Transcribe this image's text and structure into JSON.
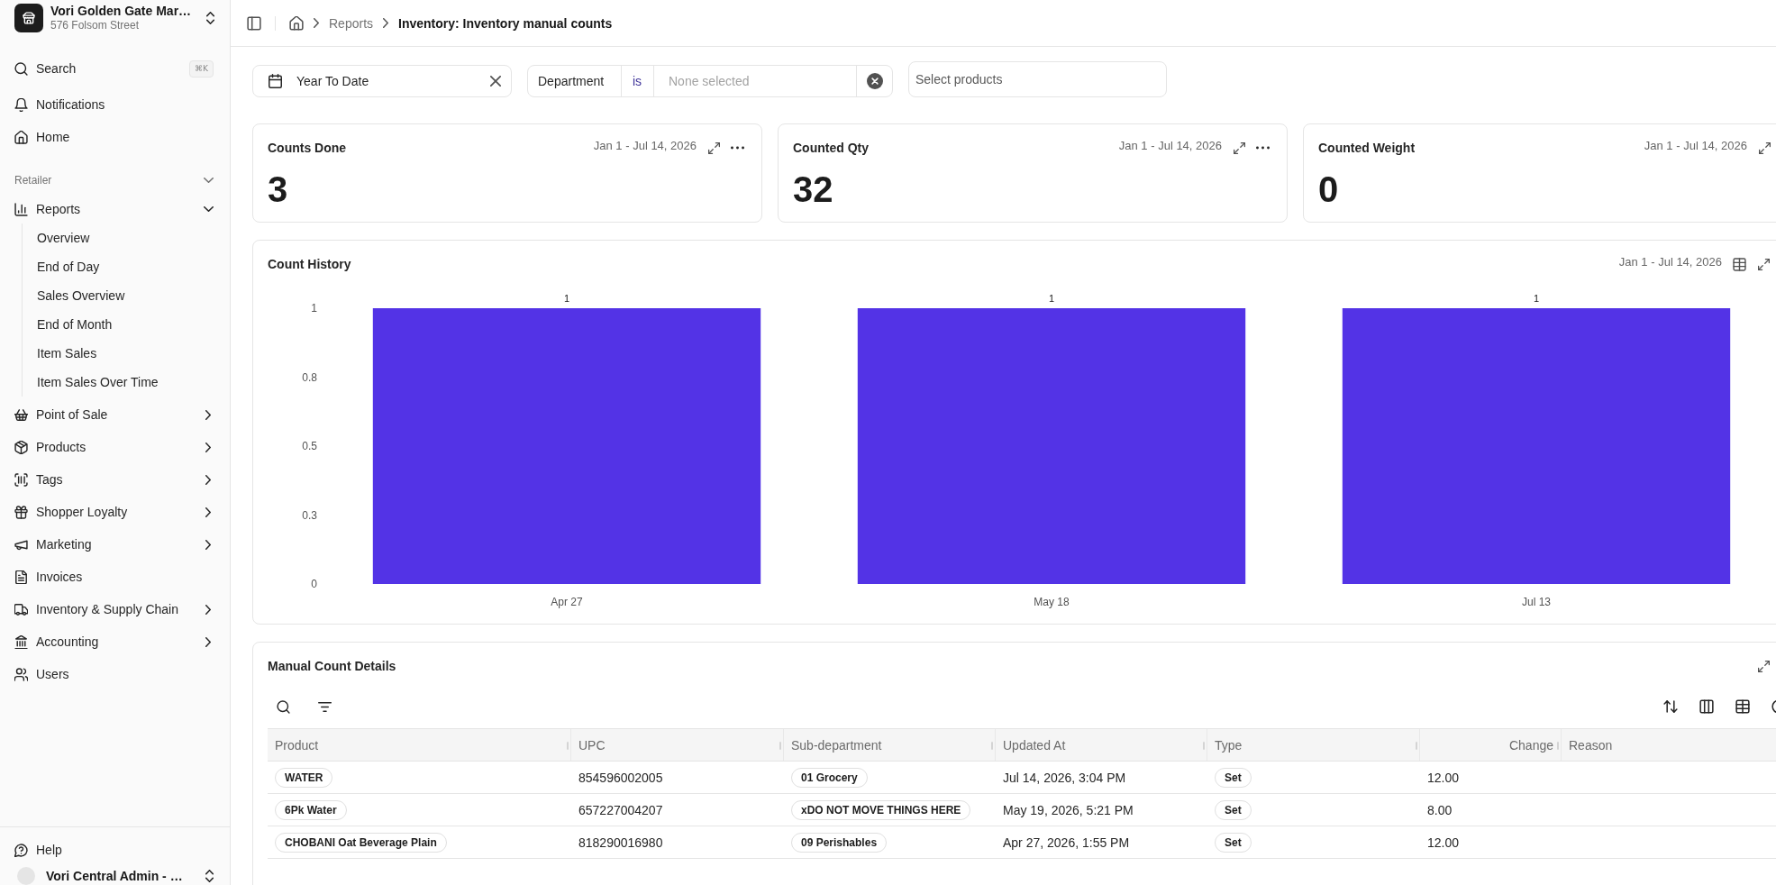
{
  "sidebar": {
    "store": {
      "name": "Vori Golden Gate Mar…",
      "address": "576 Folsom Street"
    },
    "search": {
      "label": "Search",
      "shortcut": "⌘K"
    },
    "top_items": [
      {
        "label": "Notifications"
      },
      {
        "label": "Home"
      }
    ],
    "section": {
      "label": "Retailer",
      "expanded": true
    },
    "items": [
      {
        "label": "Reports",
        "expandable": true,
        "expanded": true,
        "children": [
          {
            "label": "Overview"
          },
          {
            "label": "End of Day"
          },
          {
            "label": "Sales Overview"
          },
          {
            "label": "End of Month"
          },
          {
            "label": "Item Sales"
          },
          {
            "label": "Item Sales Over Time"
          }
        ]
      },
      {
        "label": "Point of Sale",
        "expandable": true,
        "expanded": false
      },
      {
        "label": "Products",
        "expandable": true,
        "expanded": false
      },
      {
        "label": "Tags",
        "expandable": true,
        "expanded": false
      },
      {
        "label": "Shopper Loyalty",
        "expandable": true,
        "expanded": false
      },
      {
        "label": "Marketing",
        "expandable": true,
        "expanded": false
      },
      {
        "label": "Invoices",
        "expandable": false
      },
      {
        "label": "Inventory & Supply Chain",
        "expandable": true,
        "expanded": false
      },
      {
        "label": "Accounting",
        "expandable": true,
        "expanded": false
      },
      {
        "label": "Users",
        "expandable": false
      }
    ],
    "footer": {
      "help": "Help",
      "account": "Vori Central Admin - …"
    }
  },
  "topbar": {
    "breadcrumbs": [
      {
        "label": "Reports",
        "current": false
      },
      {
        "label": "Inventory: Inventory manual counts",
        "current": true
      }
    ]
  },
  "filters": {
    "date": {
      "value": "Year To Date"
    },
    "department": {
      "label": "Department",
      "operator": "is",
      "placeholder": "None selected"
    },
    "products": {
      "placeholder": "Select products"
    }
  },
  "kpis": [
    {
      "title": "Counts Done",
      "range": "Jan 1 - Jul 14, 2026",
      "value": "3",
      "menu": true
    },
    {
      "title": "Counted Qty",
      "range": "Jan 1 - Jul 14, 2026",
      "value": "32",
      "menu": true
    },
    {
      "title": "Counted Weight",
      "range": "Jan 1 - Jul 14, 2026",
      "value": "0",
      "menu": false
    }
  ],
  "count_history": {
    "title": "Count History",
    "range": "Jan 1 - Jul 14, 2026",
    "chart_data": {
      "type": "bar",
      "categories": [
        "Apr 27",
        "May 18",
        "Jul 13"
      ],
      "series": [
        {
          "color": "#5333e6",
          "values": [
            1,
            1,
            1
          ]
        }
      ],
      "ylim": [
        0,
        1
      ],
      "yticks": [
        0,
        {
          "value": 0.25,
          "label": "0.3"
        },
        {
          "value": 0.5,
          "label": "0.5"
        },
        {
          "value": 0.75,
          "label": "0.8"
        },
        1
      ],
      "data_labels": true
    }
  },
  "details": {
    "title": "Manual Count Details",
    "columns": [
      {
        "label": "Product",
        "kind": "pill"
      },
      {
        "label": "UPC",
        "kind": "text"
      },
      {
        "label": "Sub-department",
        "kind": "pill"
      },
      {
        "label": "Updated At",
        "kind": "text"
      },
      {
        "label": "Type",
        "kind": "pill"
      },
      {
        "label": "Change",
        "kind": "number"
      },
      {
        "label": "Reason",
        "kind": "text"
      }
    ],
    "rows": [
      [
        "WATER",
        "854596002005",
        "01 Grocery",
        "Jul 14, 2026, 3:04 PM",
        "Set",
        "12.00"
      ],
      [
        "6Pk Water",
        "657227004207",
        "xDO NOT MOVE THINGS HERE",
        "May 19, 2026, 5:21 PM",
        "Set",
        "8.00"
      ],
      [
        "CHOBANI Oat Beverage Plain",
        "818290016980",
        "09 Perishables",
        "Apr 27, 2026, 1:55 PM",
        "Set",
        "12.00"
      ]
    ]
  }
}
